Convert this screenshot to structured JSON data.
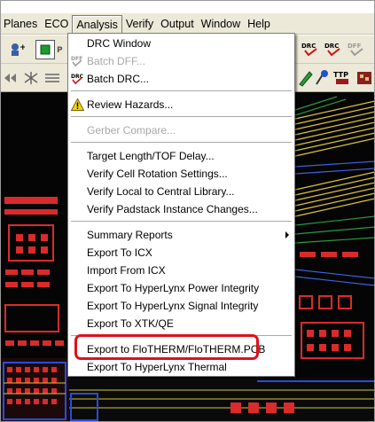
{
  "menubar": {
    "items": [
      "Planes",
      "ECO",
      "Analysis",
      "Verify",
      "Output",
      "Window",
      "Help"
    ]
  },
  "toolbar_labels": {
    "drc1": "DRC",
    "drc2": "DRC",
    "drc3": "DFF",
    "ttp": "TTP"
  },
  "analysis_menu": {
    "drc_window": "DRC Window",
    "batch_dff": "Batch DFF...",
    "batch_drc": "Batch DRC...",
    "review_hazards": "Review Hazards...",
    "gerber_compare": "Gerber Compare...",
    "target_length": "Target Length/TOF Delay...",
    "verify_cell_rotation": "Verify Cell Rotation Settings...",
    "verify_local_central": "Verify Local to Central Library...",
    "verify_padstack": "Verify Padstack Instance Changes...",
    "summary_reports": "Summary Reports",
    "export_icx": "Export To ICX",
    "import_icx": "Import From ICX",
    "export_power": "Export To HyperLynx Power Integrity",
    "export_signal": "Export To HyperLynx Signal Integrity",
    "export_xtk": "Export To XTK/QE",
    "export_flotherm": "Export to FloTHERM/FloTHERM.PCB",
    "export_thermal": "Export To HyperLynx Thermal"
  },
  "icons": {
    "dff": "DFF",
    "drc": "DRC"
  },
  "colors": {
    "highlight": "#e0101a",
    "menu_bg": "#ece9d8",
    "canvas_bg": "#050505"
  }
}
